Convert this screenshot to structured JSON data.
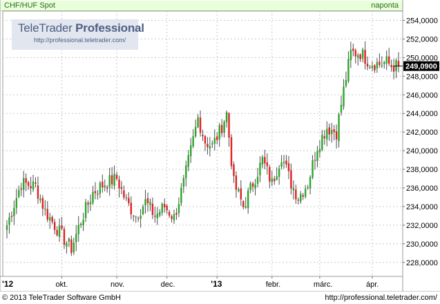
{
  "header": {
    "instrument": "CHF/HUF Spot",
    "period": "naponta"
  },
  "watermark": {
    "title_regular": "TeleTrader ",
    "title_bold": "Professional",
    "url": "http://professional.teletrader.com/"
  },
  "footer": {
    "copyright": "© 2013 TeleTrader Software GmbH",
    "url": "http://professional.teletrader.com/"
  },
  "colors": {
    "up": "#2aa62a",
    "down": "#e02020",
    "wick": "#4a4a4a",
    "grid": "#c8c8c8",
    "header_bg": "#e9ffd9",
    "last_value_bg": "#000000"
  },
  "chart_data": {
    "type": "candlestick",
    "ylim": [
      226.5,
      255.0
    ],
    "y_ticks": [
      "254,0000",
      "252,0000",
      "250,0000",
      "248,0000",
      "246,0000",
      "244,0000",
      "242,0000",
      "240,0000",
      "238,0000",
      "236,0000",
      "234,0000",
      "232,0000",
      "230,0000",
      "228,0000"
    ],
    "y_tick_values": [
      254,
      252,
      250,
      248,
      246,
      244,
      242,
      240,
      238,
      236,
      234,
      232,
      230,
      228
    ],
    "last_value": 249.09,
    "last_value_label": "249,0900",
    "x_labels": [
      {
        "text": "'12",
        "bold": true,
        "day": 0
      },
      {
        "text": "okt.",
        "bold": false,
        "day": 23
      },
      {
        "text": "nov.",
        "bold": false,
        "day": 46
      },
      {
        "text": "dec.",
        "bold": false,
        "day": 67
      },
      {
        "text": "'13",
        "bold": true,
        "day": 88
      },
      {
        "text": "febr.",
        "bold": false,
        "day": 111
      },
      {
        "text": "márc.",
        "bold": false,
        "day": 131
      },
      {
        "text": "ápr.",
        "bold": false,
        "day": 153
      }
    ],
    "x_gridline_days": [
      23,
      46,
      67,
      88,
      111,
      131,
      153
    ],
    "day_count": 165,
    "anchors": [
      {
        "d": 0,
        "c": 232.0
      },
      {
        "d": 6,
        "c": 236.5
      },
      {
        "d": 12,
        "c": 236.2
      },
      {
        "d": 16,
        "c": 233.5
      },
      {
        "d": 20,
        "c": 232.0
      },
      {
        "d": 24,
        "c": 230.5
      },
      {
        "d": 27,
        "c": 229.5
      },
      {
        "d": 31,
        "c": 232.5
      },
      {
        "d": 36,
        "c": 235.5
      },
      {
        "d": 41,
        "c": 236.5
      },
      {
        "d": 46,
        "c": 237.0
      },
      {
        "d": 50,
        "c": 234.5
      },
      {
        "d": 54,
        "c": 233.0
      },
      {
        "d": 58,
        "c": 234.5
      },
      {
        "d": 62,
        "c": 233.0
      },
      {
        "d": 66,
        "c": 234.0
      },
      {
        "d": 70,
        "c": 232.8
      },
      {
        "d": 74,
        "c": 236.5
      },
      {
        "d": 77,
        "c": 240.0
      },
      {
        "d": 80,
        "c": 243.5
      },
      {
        "d": 83,
        "c": 241.0
      },
      {
        "d": 86,
        "c": 240.5
      },
      {
        "d": 89,
        "c": 242.0
      },
      {
        "d": 92,
        "c": 244.0
      },
      {
        "d": 95,
        "c": 236.5
      },
      {
        "d": 99,
        "c": 234.0
      },
      {
        "d": 103,
        "c": 236.5
      },
      {
        "d": 107,
        "c": 239.0
      },
      {
        "d": 111,
        "c": 236.5
      },
      {
        "d": 115,
        "c": 239.5
      },
      {
        "d": 119,
        "c": 236.5
      },
      {
        "d": 122,
        "c": 235.0
      },
      {
        "d": 126,
        "c": 236.5
      },
      {
        "d": 130,
        "c": 240.5
      },
      {
        "d": 134,
        "c": 242.5
      },
      {
        "d": 138,
        "c": 242.0
      },
      {
        "d": 141,
        "c": 246.5
      },
      {
        "d": 144,
        "c": 250.5
      },
      {
        "d": 148,
        "c": 250.5
      },
      {
        "d": 152,
        "c": 249.5
      },
      {
        "d": 156,
        "c": 249.3
      },
      {
        "d": 159,
        "c": 249.5
      },
      {
        "d": 161,
        "c": 249.09
      }
    ]
  }
}
